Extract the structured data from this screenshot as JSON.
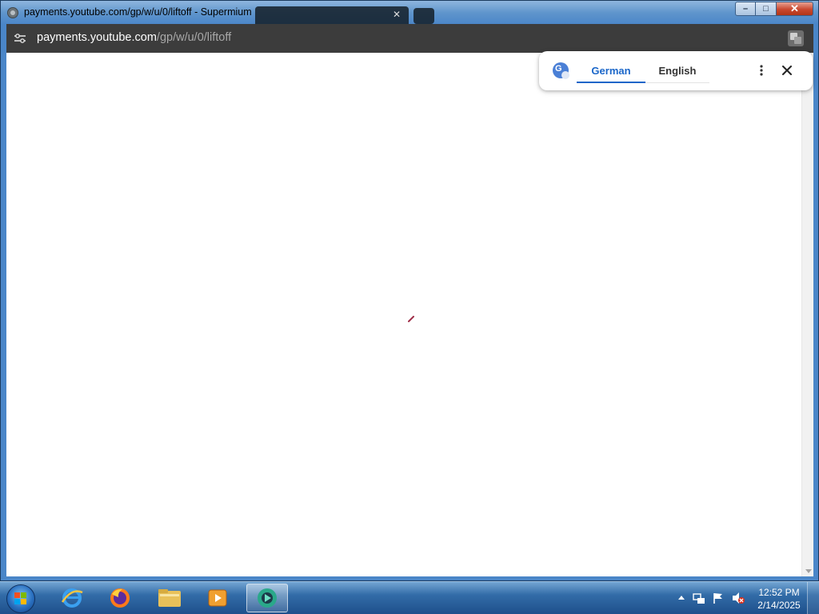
{
  "window": {
    "title": "payments.youtube.com/gp/w/u/0/liftoff - Supermium",
    "minimize_label": "–",
    "maximize_label": "□",
    "close_label": "✕"
  },
  "toolbar": {
    "url_host": "payments.youtube.com",
    "url_path": "/gp/w/u/0/liftoff"
  },
  "translate_bubble": {
    "tab_source": "German",
    "tab_target": "English",
    "more_label": "⋮",
    "close_label": "✕"
  },
  "taskbar": {
    "apps": [
      {
        "name": "internet-explorer",
        "icon": "ie-icon"
      },
      {
        "name": "firefox",
        "icon": "firefox-icon"
      },
      {
        "name": "file-explorer",
        "icon": "folder-icon"
      },
      {
        "name": "media-player",
        "icon": "media-player-icon"
      },
      {
        "name": "supermium",
        "icon": "supermium-icon",
        "active": true
      }
    ],
    "time": "12:52 PM",
    "date": "2/14/2025"
  },
  "colors": {
    "accent": "#1a66c9",
    "titlebar": "#4a86c8",
    "toolbar": "#3c3c3c",
    "close_button": "#c9482e"
  }
}
